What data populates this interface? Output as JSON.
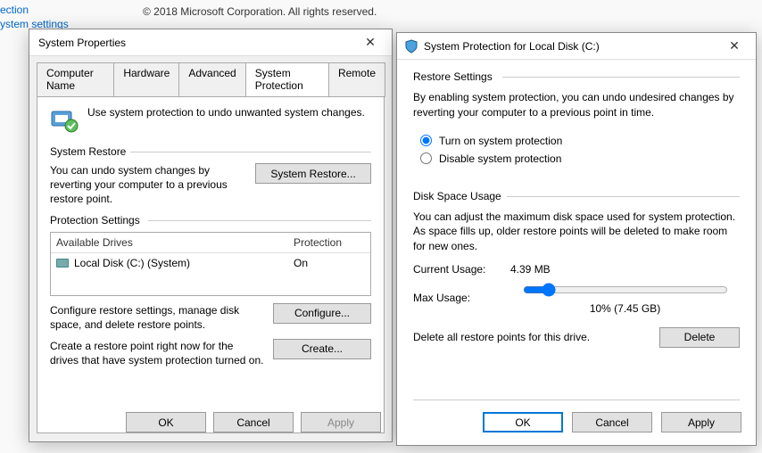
{
  "background": {
    "link1": "ection",
    "link2": "ystem settings",
    "copyright": "© 2018 Microsoft Corporation. All rights reserved."
  },
  "sysprops": {
    "title": "System Properties",
    "tabs": [
      "Computer Name",
      "Hardware",
      "Advanced",
      "System Protection",
      "Remote"
    ],
    "active_tab": "System Protection",
    "intro": "Use system protection to undo unwanted system changes.",
    "restore": {
      "title": "System Restore",
      "text": "You can undo system changes by reverting your computer to a previous restore point.",
      "button": "System Restore..."
    },
    "protection": {
      "title": "Protection Settings",
      "col1": "Available Drives",
      "col2": "Protection",
      "drive_name": "Local Disk (C:) (System)",
      "drive_status": "On",
      "configure_text": "Configure restore settings, manage disk space, and delete restore points.",
      "configure_btn": "Configure...",
      "create_text": "Create a restore point right now for the drives that have system protection turned on.",
      "create_btn": "Create..."
    },
    "buttons": {
      "ok": "OK",
      "cancel": "Cancel",
      "apply": "Apply"
    }
  },
  "sps": {
    "title": "System Protection for Local Disk (C:)",
    "restore_settings": {
      "title": "Restore Settings",
      "desc": "By enabling system protection, you can undo undesired changes by reverting your computer to a previous point in time.",
      "opt_on": "Turn on system protection",
      "opt_off": "Disable system protection"
    },
    "disk": {
      "title": "Disk Space Usage",
      "desc": "You can adjust the maximum disk space used for system protection. As space fills up, older restore points will be deleted to make room for new ones.",
      "current_label": "Current Usage:",
      "current_value": "4.39 MB",
      "max_label": "Max Usage:",
      "max_display": "10% (7.45 GB)",
      "delete_text": "Delete all restore points for this drive.",
      "delete_btn": "Delete"
    },
    "buttons": {
      "ok": "OK",
      "cancel": "Cancel",
      "apply": "Apply"
    }
  }
}
